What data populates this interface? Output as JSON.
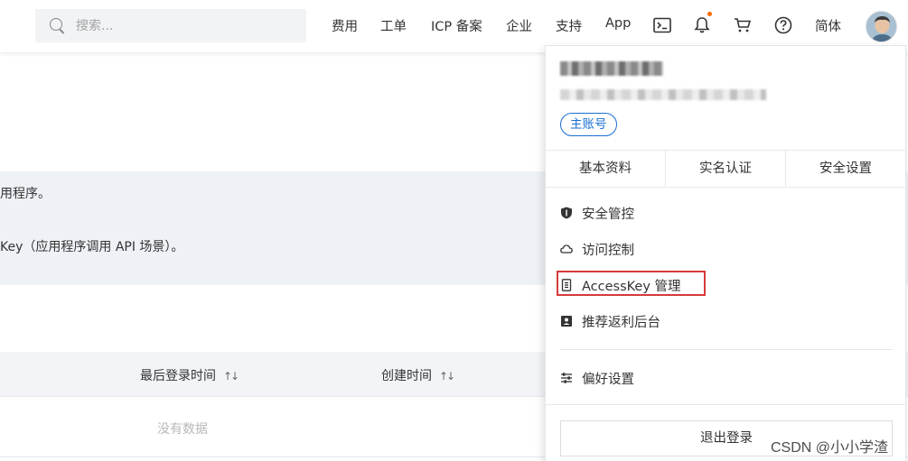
{
  "topbar": {
    "search_placeholder": "搜索...",
    "nav": [
      "费用",
      "工单",
      "ICP 备案",
      "企业",
      "支持",
      "App"
    ],
    "lang": "简体"
  },
  "page": {
    "banner_line1": "用程序。",
    "banner_line2": "Key（应用程序调用 API 场景）。",
    "columns": [
      "最后登录时间",
      "创建时间"
    ],
    "empty_text": "没有数据"
  },
  "panel": {
    "badge": "主账号",
    "tabs": [
      "基本资料",
      "实名认证",
      "安全设置"
    ],
    "menu": [
      "安全管控",
      "访问控制",
      "AccessKey 管理",
      "推荐返利后台"
    ],
    "prefs": "偏好设置",
    "logout": "退出登录"
  },
  "watermark": "CSDN @小小学渣",
  "colors": {
    "accent": "#1a6fd1",
    "highlight_border": "#d63a3a",
    "notification_dot": "#ff6a00"
  }
}
